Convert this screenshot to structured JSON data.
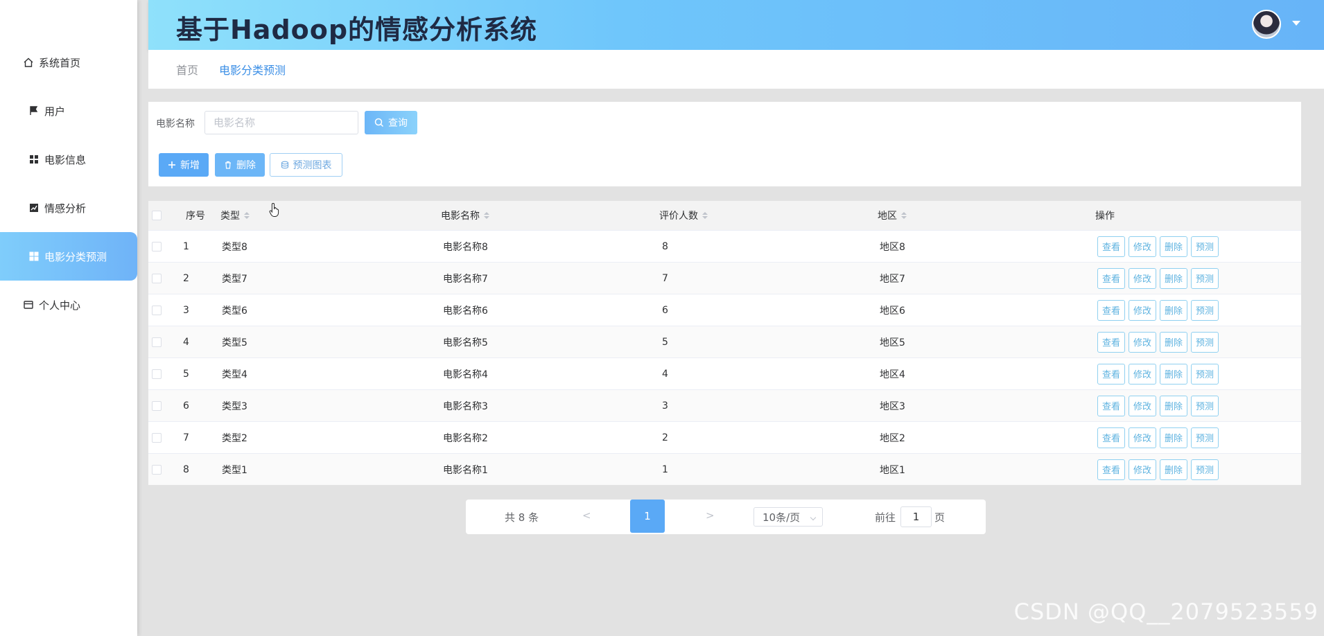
{
  "header": {
    "title": "基于Hadoop的情感分析系统"
  },
  "sidebar": {
    "items": [
      {
        "label": "系统首页",
        "icon": "home-icon"
      },
      {
        "label": "用户",
        "icon": "flag-icon"
      },
      {
        "label": "电影信息",
        "icon": "grid-icon"
      },
      {
        "label": "情感分析",
        "icon": "chart-icon"
      },
      {
        "label": "电影分类预测",
        "icon": "grid-icon",
        "active": true
      },
      {
        "label": "个人中心",
        "icon": "card-icon"
      }
    ]
  },
  "breadcrumb": {
    "home": "首页",
    "current": "电影分类预测"
  },
  "search": {
    "label": "电影名称",
    "placeholder": "电影名称",
    "query_label": "查询"
  },
  "toolbar": {
    "add_label": "新增",
    "delete_label": "删除",
    "chart_label": "预测图表"
  },
  "table": {
    "columns": [
      "序号",
      "类型",
      "电影名称",
      "评价人数",
      "地区",
      "操作"
    ],
    "actions": [
      "查看",
      "修改",
      "删除",
      "预测"
    ],
    "rows": [
      [
        "1",
        "类型8",
        "电影名称8",
        "8",
        "地区8"
      ],
      [
        "2",
        "类型7",
        "电影名称7",
        "7",
        "地区7"
      ],
      [
        "3",
        "类型6",
        "电影名称6",
        "6",
        "地区6"
      ],
      [
        "4",
        "类型5",
        "电影名称5",
        "5",
        "地区5"
      ],
      [
        "5",
        "类型4",
        "电影名称4",
        "4",
        "地区4"
      ],
      [
        "6",
        "类型3",
        "电影名称3",
        "3",
        "地区3"
      ],
      [
        "7",
        "类型2",
        "电影名称2",
        "2",
        "地区2"
      ],
      [
        "8",
        "类型1",
        "电影名称1",
        "1",
        "地区1"
      ]
    ]
  },
  "pagination": {
    "total": "共 8 条",
    "prev": "<",
    "page": "1",
    "next": ">",
    "page_size": "10条/页",
    "goto": "前往",
    "jump_value": "1",
    "unit": "页"
  },
  "watermark": "CSDN @QQ__2079523559",
  "colors": {
    "accent": "#5aa9f6",
    "header_start": "#8fe1fb",
    "header_end": "#67b4f8"
  }
}
